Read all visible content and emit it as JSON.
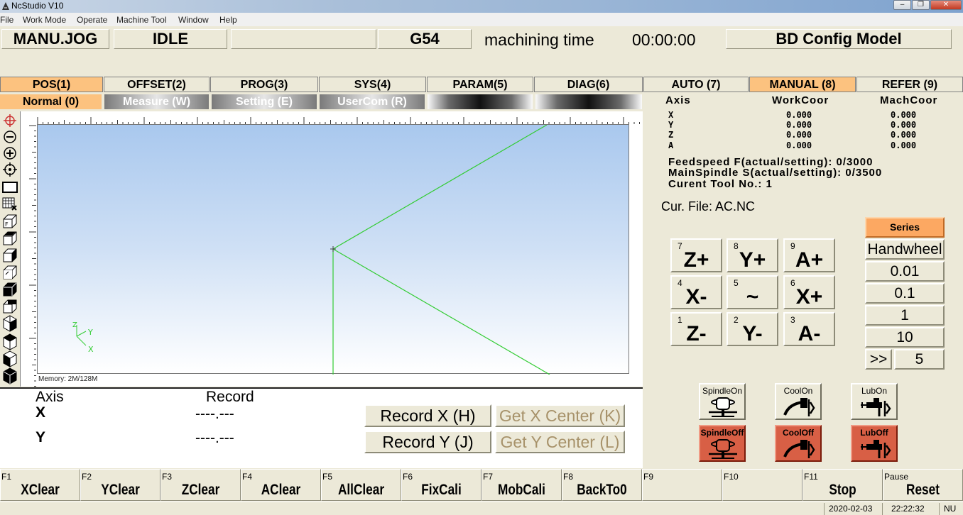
{
  "window": {
    "title": "NcStudio V10",
    "btn_min": "–",
    "btn_max": "❐",
    "btn_close": "✕"
  },
  "menu": [
    "File",
    "Work Mode",
    "Operate",
    "Machine Tool",
    "Window",
    "Help"
  ],
  "status": {
    "mode": "MANU.JOG",
    "state": "IDLE",
    "blank": "",
    "coord_sys": "G54",
    "time_label": "machining time",
    "time_value": "00:00:00",
    "model": "BD Config Model"
  },
  "tabs_main": [
    {
      "label": "POS(1)",
      "active": true
    },
    {
      "label": "OFFSET(2)",
      "active": false
    },
    {
      "label": "PROG(3)",
      "active": false
    },
    {
      "label": "SYS(4)",
      "active": false
    },
    {
      "label": "PARAM(5)",
      "active": false
    },
    {
      "label": "DIAG(6)",
      "active": false
    },
    {
      "label": "AUTO (7)",
      "active": false
    },
    {
      "label": "MANUAL (8)",
      "active": true
    },
    {
      "label": "REFER (9)",
      "active": false
    }
  ],
  "tabs_sub": [
    {
      "label": "Normal (0)",
      "active": true
    },
    {
      "label": "Measure (W)",
      "active": false
    },
    {
      "label": "Setting (E)",
      "active": false
    },
    {
      "label": "UserCom (R)",
      "active": false
    },
    {
      "label": "",
      "active": false
    },
    {
      "label": "",
      "active": false
    }
  ],
  "viewport": {
    "memory": "Memory: 2M/128M",
    "triad": {
      "z": "Z",
      "y": "Y",
      "x": "X"
    }
  },
  "record": {
    "axis_header": "Axis",
    "record_header": "Record",
    "rows": [
      {
        "axis": "X",
        "value": "----.---",
        "record_btn": "Record X (H)",
        "center_btn": "Get X Center (K)"
      },
      {
        "axis": "Y",
        "value": "----.---",
        "record_btn": "Record Y (J)",
        "center_btn": "Get Y Center (L)"
      }
    ]
  },
  "coords": {
    "headers": {
      "axis": "Axis",
      "work": "WorkCoor",
      "mach": "MachCoor"
    },
    "rows": [
      {
        "axis": "X",
        "work": "0.000",
        "mach": "0.000"
      },
      {
        "axis": "Y",
        "work": "0.000",
        "mach": "0.000"
      },
      {
        "axis": "Z",
        "work": "0.000",
        "mach": "0.000"
      },
      {
        "axis": "A",
        "work": "0.000",
        "mach": "0.000"
      }
    ],
    "feed": "Feedspeed F(actual/setting):  0/3000",
    "spindle": "MainSpindle S(actual/setting):  0/3500",
    "tool": "Curent Tool No.:  1",
    "file": "Cur. File: AC.NC"
  },
  "jog": [
    {
      "num": "7",
      "label": "Z+"
    },
    {
      "num": "8",
      "label": "Y+"
    },
    {
      "num": "9",
      "label": "A+"
    },
    {
      "num": "4",
      "label": "X-"
    },
    {
      "num": "5",
      "label": "~"
    },
    {
      "num": "6",
      "label": "X+"
    },
    {
      "num": "1",
      "label": "Z-"
    },
    {
      "num": "2",
      "label": "Y-"
    },
    {
      "num": "3",
      "label": "A-"
    }
  ],
  "step": {
    "series": "Series",
    "handwheel": "Handwheel",
    "values": [
      "0.01",
      "0.1",
      "1",
      "10"
    ],
    "more": ">>",
    "custom": "5"
  },
  "io": [
    {
      "label": "SpindleOn",
      "icon": "spindle-icon"
    },
    {
      "label": "CoolOn",
      "icon": "coolant-icon"
    },
    {
      "label": "LubOn",
      "icon": "lube-icon"
    },
    {
      "label": "SpindleOff",
      "icon": "spindle-icon"
    },
    {
      "label": "CoolOff",
      "icon": "coolant-icon"
    },
    {
      "label": "LubOff",
      "icon": "lube-icon"
    }
  ],
  "fkeys": [
    {
      "num": "F1",
      "label": "XClear"
    },
    {
      "num": "F2",
      "label": "YClear"
    },
    {
      "num": "F3",
      "label": "ZClear"
    },
    {
      "num": "F4",
      "label": "AClear"
    },
    {
      "num": "F5",
      "label": "AllClear"
    },
    {
      "num": "F6",
      "label": "FixCali"
    },
    {
      "num": "F7",
      "label": "MobCali"
    },
    {
      "num": "F8",
      "label": "BackTo0"
    },
    {
      "num": "F9",
      "label": ""
    },
    {
      "num": "F10",
      "label": ""
    },
    {
      "num": "F11",
      "label": "Stop"
    },
    {
      "num": "Pause",
      "label": "Reset"
    }
  ],
  "statusbar": {
    "date": "2020-02-03",
    "time": "22:22:32",
    "extra": "NU"
  },
  "colors": {
    "tab_active": "#fcc27f",
    "off_button": "#d85f45",
    "toolpath": "#33cc33",
    "series_button": "#fca862"
  }
}
